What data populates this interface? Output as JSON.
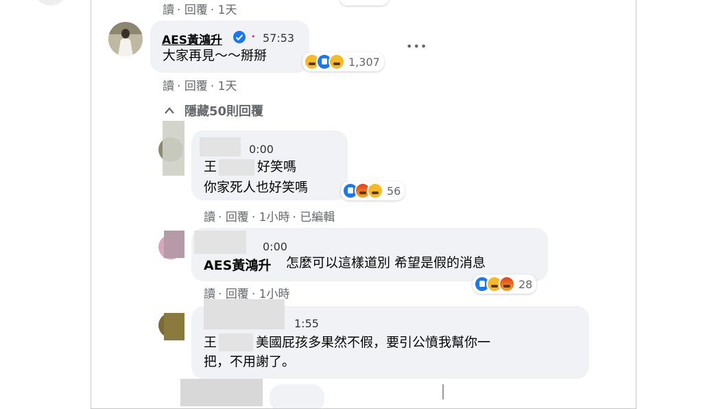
{
  "top_meta": {
    "read": "讀",
    "reply": "回覆",
    "time": "1天"
  },
  "main_comment": {
    "author": "AES黃鴻升",
    "time": "57:53",
    "text": "大家再見～～掰掰",
    "reactions": "1,307",
    "more": "•••",
    "meta": {
      "read": "讀",
      "reply": "回覆",
      "time": "1天"
    }
  },
  "hide_replies": {
    "label": "隱藏50則回覆"
  },
  "replies": [
    {
      "time": "0:00",
      "line1_prefix": "王",
      "line1_suffix": "好笑嗎",
      "line2": "你家死人也好笑嗎",
      "reactions": "56",
      "meta": {
        "read": "讀",
        "reply": "回覆",
        "time": "1小時",
        "edited": "已編輯"
      }
    },
    {
      "time": "0:00",
      "mention": "AES黃鴻升",
      "text": "怎麼可以這樣道別 希望是假的消息",
      "reactions": "28",
      "meta": {
        "read": "讀",
        "reply": "回覆",
        "time": "1小時"
      }
    },
    {
      "time": "1:55",
      "line1_prefix": "王",
      "line1_suffix": "美國屁孩多果然不假，要引公憤我幫你一",
      "line2": "把，不用謝了。"
    }
  ],
  "colors": {
    "like": "#1877f2",
    "meta_gray": "#65676b",
    "bubble": "#f0f2f5",
    "verified": "#1877f2"
  }
}
